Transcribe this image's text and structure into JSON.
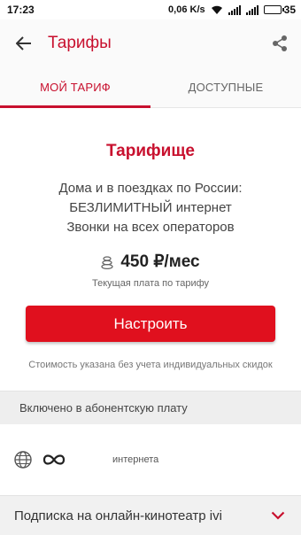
{
  "status_bar": {
    "time": "17:23",
    "speed": "0,06 K/s",
    "battery": "35"
  },
  "app_bar": {
    "title": "Тарифы"
  },
  "tabs": [
    {
      "label": "МОЙ ТАРИФ",
      "active": true
    },
    {
      "label": "ДОСТУПНЫЕ",
      "active": false
    }
  ],
  "tariff": {
    "name": "Тарифище",
    "description_lines": [
      "Дома и в поездках по России:",
      "БЕЗЛИМИТНЫЙ интернет",
      "Звонки на всех операторов"
    ],
    "price": "450 ₽/мес",
    "price_note": "Текущая плата по тарифу"
  },
  "actions": {
    "configure_label": "Настроить"
  },
  "disclaimer": "Стоимость указана без учета индивидуальных скидок",
  "included": {
    "header": "Включено в абонентскую плату",
    "items": [
      {
        "value_icon": "infinity-icon",
        "label": "интернета"
      }
    ]
  },
  "subscription": {
    "label": "Подписка на онлайн-кинотеатр ivi"
  },
  "colors": {
    "brand_red": "#c8102e",
    "button_red": "#e0101e"
  }
}
